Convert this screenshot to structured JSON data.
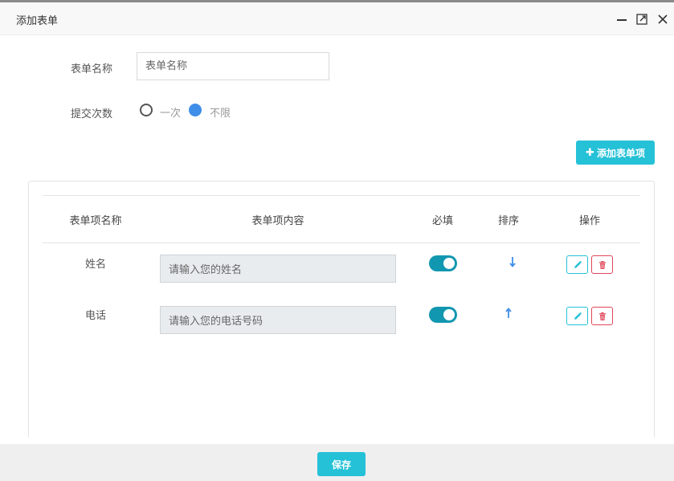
{
  "dialog": {
    "title": "添加表单"
  },
  "form": {
    "name_label": "表单名称",
    "name_placeholder": "表单名称",
    "name_value": "",
    "submit_label": "提交次数",
    "submit_options": [
      {
        "label": "一次",
        "selected": false
      },
      {
        "label": "不限",
        "selected": true
      }
    ]
  },
  "add_item_button": {
    "label": "添加表单项",
    "icon": "plus-icon"
  },
  "table": {
    "headers": [
      "表单项名称",
      "表单项内容",
      "必填",
      "排序",
      "操作"
    ],
    "rows": [
      {
        "name": "姓名",
        "content_placeholder": "请输入您的姓名",
        "required": true,
        "sort": "down"
      },
      {
        "name": "电话",
        "content_placeholder": "请输入您的电话号码",
        "required": true,
        "sort": "up"
      }
    ]
  },
  "footer": {
    "save_label": "保存"
  },
  "colors": {
    "accent": "#25c1d7",
    "toggle_on": "#1297b0",
    "radio_selected": "#3f8ee8",
    "danger": "#e0475a",
    "sort_arrow": "#3f8ee8"
  }
}
